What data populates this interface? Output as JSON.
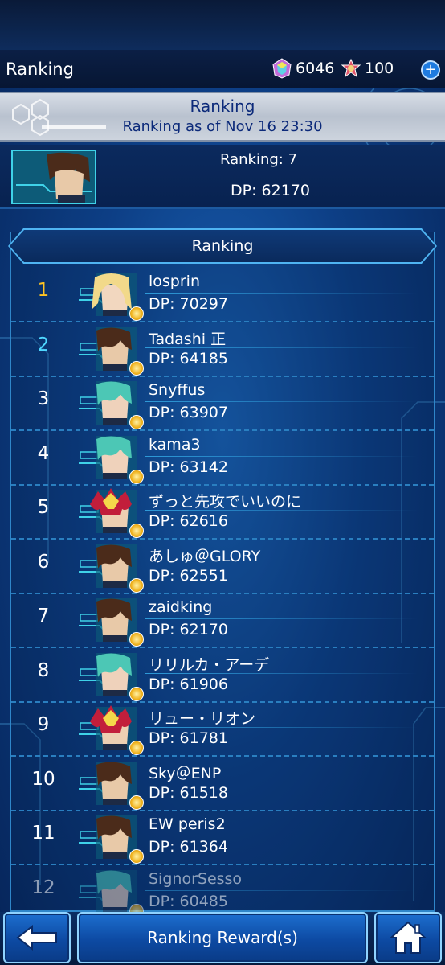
{
  "top_bar": {
    "title": "Ranking",
    "gems": "6046",
    "tickets": "100",
    "plus_icon": "plus-icon"
  },
  "header": {
    "title": "Ranking",
    "subtitle": "Ranking as of Nov 16 23:30"
  },
  "self": {
    "ranking": "Ranking: 7",
    "dp": "DP: 62170"
  },
  "list": {
    "title": "Ranking",
    "rows": [
      {
        "rank": "1",
        "name": "losprin",
        "dp": "DP: 70297",
        "avatar": "blonde"
      },
      {
        "rank": "2",
        "name": "Tadashi 正",
        "dp": "DP: 64185",
        "avatar": "kaiba"
      },
      {
        "rank": "3",
        "name": "Snyffus",
        "dp": "DP: 63907",
        "avatar": "teal"
      },
      {
        "rank": "4",
        "name": "kama3",
        "dp": "DP: 63142",
        "avatar": "teal"
      },
      {
        "rank": "5",
        "name": "ずっと先攻でいいのに",
        "dp": "DP: 62616",
        "avatar": "yugi"
      },
      {
        "rank": "6",
        "name": "あしゅ＠GLORY",
        "dp": "DP: 62551",
        "avatar": "kaiba"
      },
      {
        "rank": "7",
        "name": "zaidking",
        "dp": "DP: 62170",
        "avatar": "kaiba"
      },
      {
        "rank": "8",
        "name": "リリルカ・アーデ",
        "dp": "DP: 61906",
        "avatar": "teal"
      },
      {
        "rank": "9",
        "name": "リュー・リオン",
        "dp": "DP: 61781",
        "avatar": "yugi"
      },
      {
        "rank": "10",
        "name": "Sky＠ENP",
        "dp": "DP: 61518",
        "avatar": "kaiba"
      },
      {
        "rank": "11",
        "name": "EW peris2",
        "dp": "DP: 61364",
        "avatar": "kaiba"
      },
      {
        "rank": "12",
        "name": "SignorSesso",
        "dp": "DP: 60485",
        "avatar": "teal"
      }
    ]
  },
  "bottom": {
    "back_icon": "arrow-left-icon",
    "reward_label": "Ranking Reward(s)",
    "home_icon": "home-icon"
  },
  "colors": {
    "gold_rank": "#ffc422",
    "cyan_rank": "#4fd7ff",
    "header_text": "#0c2a7a"
  }
}
